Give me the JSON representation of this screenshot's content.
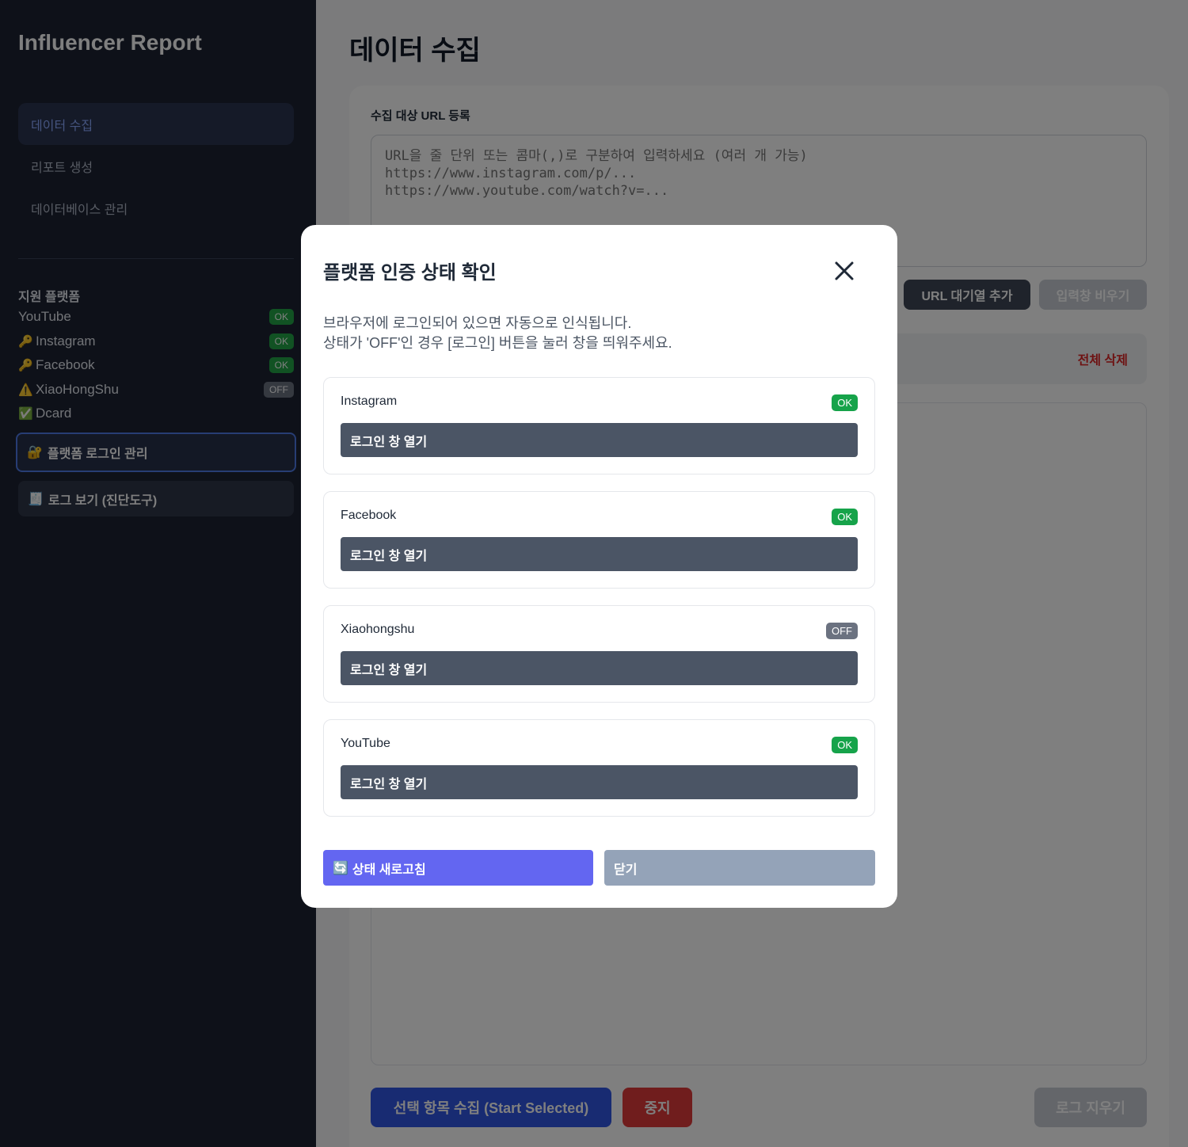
{
  "sidebar": {
    "app_title": "Influencer Report",
    "nav": [
      {
        "label": "데이터 수집",
        "active": true
      },
      {
        "label": "리포트 생성",
        "active": false
      },
      {
        "label": "데이터베이스 관리",
        "active": false
      }
    ],
    "section_title": "지원 플랫폼",
    "platforms": [
      {
        "icon": "",
        "name": "YouTube",
        "status": "OK"
      },
      {
        "icon": "🔑",
        "name": "Instagram",
        "status": "OK"
      },
      {
        "icon": "🔑",
        "name": "Facebook",
        "status": "OK"
      },
      {
        "icon": "⚠️",
        "name": "XiaoHongShu",
        "status": "OFF"
      },
      {
        "icon": "✅",
        "name": "Dcard",
        "status": ""
      }
    ],
    "login_manage_icon": "🔐",
    "login_manage_label": "플랫폼 로그인 관리",
    "log_view_icon": "🧾",
    "log_view_label": "로그 보기 (진단도구)"
  },
  "main": {
    "page_title": "데이터 수집",
    "url_section_label": "수집 대상 URL 등록",
    "url_placeholder": "URL을 줄 단위 또는 콤마(,)로 구분하여 입력하세요 (여러 개 가능)\nhttps://www.instagram.com/p/...\nhttps://www.youtube.com/watch?v=...",
    "queue_button": "URL 대기열 추가",
    "clear_input_button": "입력창 비우기",
    "delete_all": "전체 삭제",
    "start_button": "선택 항목 수집 (Start Selected)",
    "stop_button": "중지",
    "clear_log_button": "로그 지우기"
  },
  "modal": {
    "title": "플랫폼 인증 상태 확인",
    "description_line1": "브라우저에 로그인되어 있으면 자동으로 인식됩니다.",
    "description_line2": "상태가 'OFF'인 경우 [로그인] 버튼을 눌러 창을 띄워주세요.",
    "platforms": [
      {
        "name": "Instagram",
        "status": "OK",
        "button": "로그인 창 열기"
      },
      {
        "name": "Facebook",
        "status": "OK",
        "button": "로그인 창 열기"
      },
      {
        "name": "Xiaohongshu",
        "status": "OFF",
        "button": "로그인 창 열기"
      },
      {
        "name": "YouTube",
        "status": "OK",
        "button": "로그인 창 열기"
      }
    ],
    "refresh_icon": "🔄",
    "refresh_button": "상태 새로고침",
    "close_button": "닫기"
  },
  "colors": {
    "sidebar_bg": "#1d2333",
    "accent": "#6366f1",
    "ok": "#16a34a",
    "off": "#6b7280",
    "danger": "#dc2626"
  }
}
